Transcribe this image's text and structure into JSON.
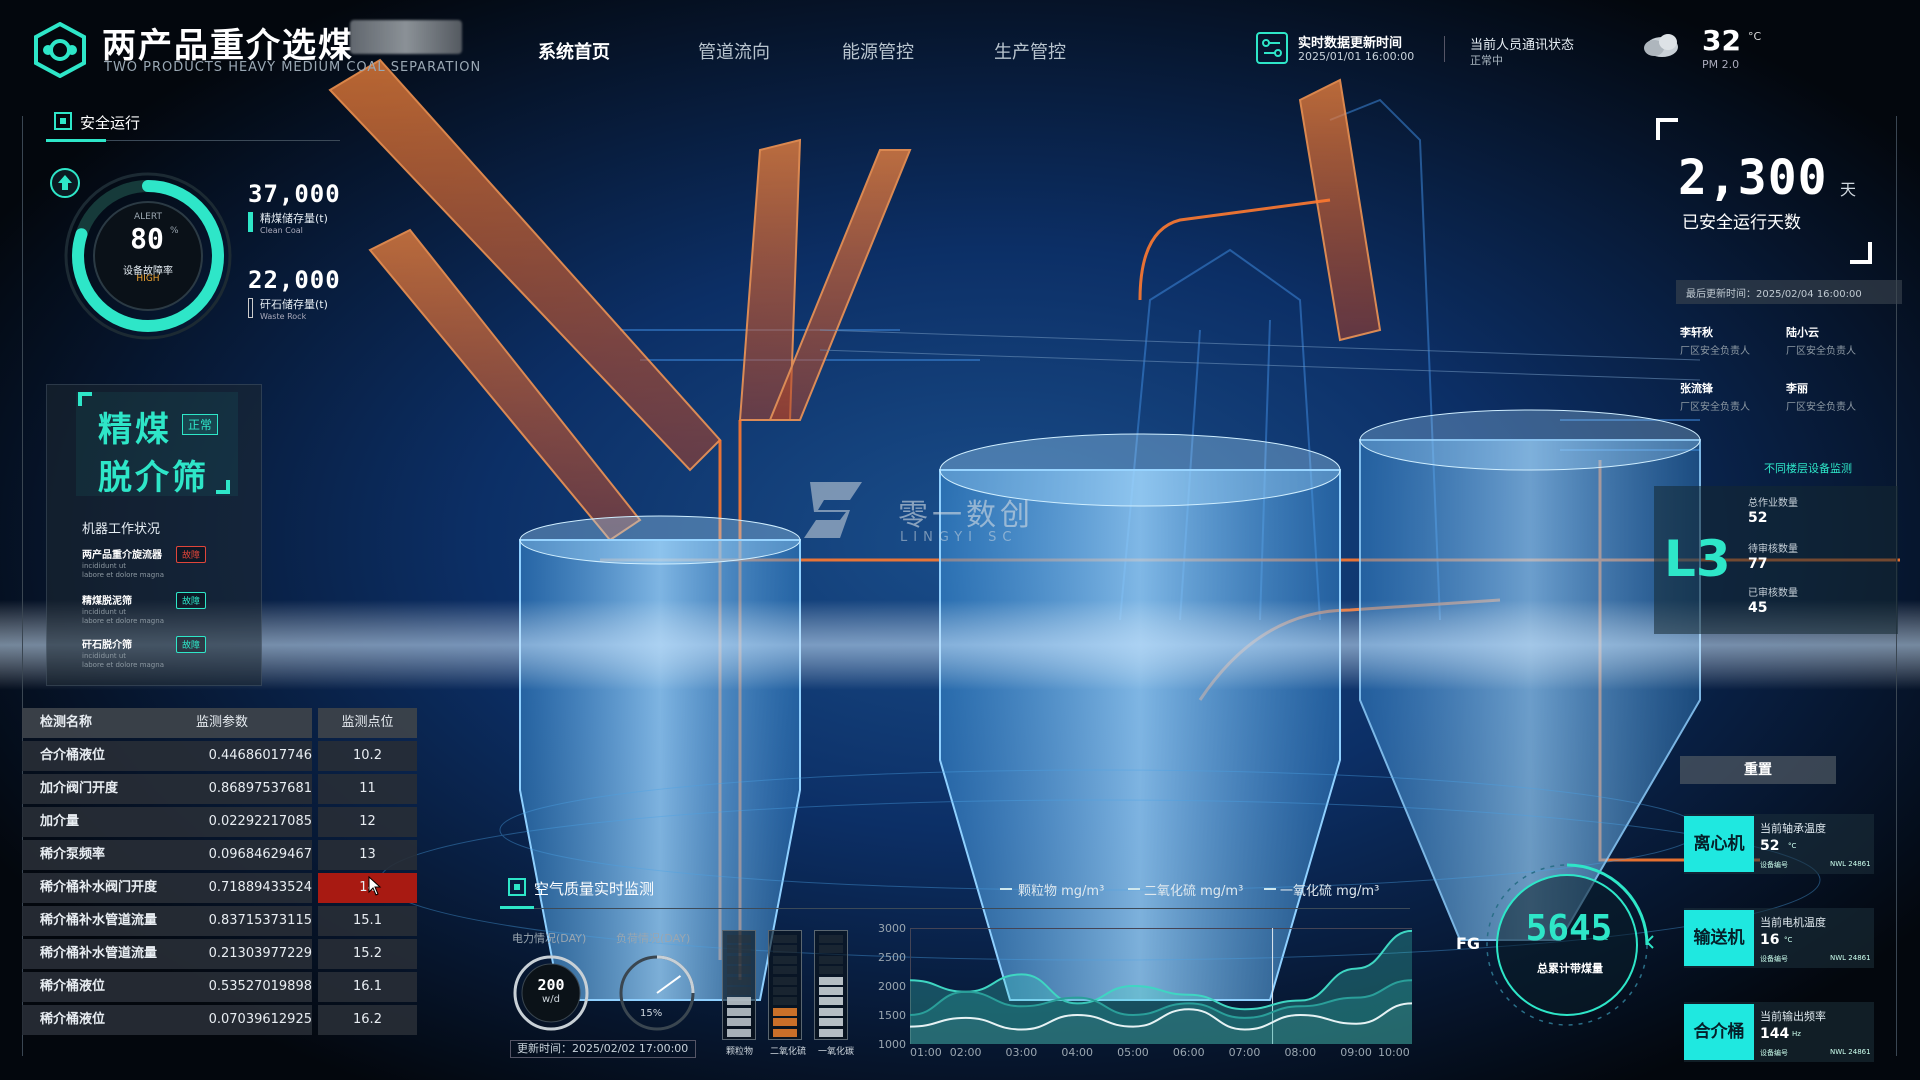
{
  "header": {
    "title": "两产品重介选煤",
    "subtitle": "TWO PRODUCTS HEAVY MEDIUM COAL SEPARATION",
    "nav": [
      "系统首页",
      "管道流向",
      "能源管控",
      "生产管控"
    ],
    "realtime_title": "实时数据更新时间",
    "realtime_time": "2025/01/01 16:00:00",
    "comm_title": "当前人员通讯状态",
    "comm_status": "正常中",
    "temperature": "32",
    "temp_unit": "°C",
    "pm": "PM 2.0"
  },
  "safety": {
    "title": "安全运行",
    "gauge_alert": "ALERT",
    "gauge_value": "80",
    "gauge_pct": "%",
    "gauge_label": "设备故障率",
    "gauge_level": "HIGH",
    "gauge_fraction": 0.8,
    "clean_value": "37,000",
    "clean_label": "精煤储存量(t)",
    "clean_en": "Clean Coal",
    "waste_value": "22,000",
    "waste_label": "矸石储存量(t)",
    "waste_en": "Waste Rock"
  },
  "equipment": {
    "line1": "精煤",
    "badge": "正常",
    "line2": "脱介筛",
    "work_title": "机器工作状况",
    "machines": [
      {
        "name": "两产品重介旋流器",
        "status": "故障",
        "color": "#e0453a",
        "sub1": "incididunt ut",
        "sub2": "labore et dolore magna"
      },
      {
        "name": "精煤脱泥筛",
        "status": "故障",
        "color": "#2ee6c8",
        "sub1": "incididunt ut",
        "sub2": "labore et dolore magna"
      },
      {
        "name": "矸石脱介筛",
        "status": "故障",
        "color": "#2ee6c8",
        "sub1": "incididunt ut",
        "sub2": "labore et dolore magna"
      }
    ]
  },
  "table": {
    "headers": [
      "检测名称",
      "监测参数",
      "监测点位"
    ],
    "rows": [
      {
        "name": "合介桶液位",
        "param": "0.44686017746",
        "point": "10.2"
      },
      {
        "name": "加介阀门开度",
        "param": "0.86897537681",
        "point": "11"
      },
      {
        "name": "加介量",
        "param": "0.02292217085",
        "point": "12"
      },
      {
        "name": "稀介泵频率",
        "param": "0.09684629467",
        "point": "13"
      },
      {
        "name": "稀介桶补水阀门开度",
        "param": "0.71889433524",
        "point": "14"
      },
      {
        "name": "稀介桶补水管道流量",
        "param": "0.83715373115",
        "point": "15.1"
      },
      {
        "name": "稀介桶补水管道流量",
        "param": "0.21303977229",
        "point": "15.2"
      },
      {
        "name": "稀介桶液位",
        "param": "0.53527019898",
        "point": "16.1"
      },
      {
        "name": "稀介桶液位",
        "param": "0.07039612925",
        "point": "16.2"
      }
    ]
  },
  "right": {
    "days": "2,300",
    "days_unit": "天",
    "days_label": "已安全运行天数",
    "last_update": "最后更新时间：2025/02/04 16:00:00",
    "people": [
      {
        "name": "李轩秋",
        "role": "厂区安全负责人"
      },
      {
        "name": "陆小云",
        "role": "厂区安全负责人"
      },
      {
        "name": "张流锋",
        "role": "厂区安全负责人"
      },
      {
        "name": "李丽",
        "role": "厂区安全负责人"
      }
    ],
    "floor_title": "不同楼层设备监测",
    "floor_name": "L3",
    "floor_stats": [
      {
        "label": "总作业数量",
        "value": "52"
      },
      {
        "label": "待审核数量",
        "value": "77"
      },
      {
        "label": "已审核数量",
        "value": "45"
      }
    ],
    "reset_label": "重置",
    "devices": [
      {
        "name": "离心机",
        "label": "当前轴承温度",
        "value": "52",
        "unit": "°C",
        "tag": "设备编号",
        "code": "NWL 24861"
      },
      {
        "name": "输送机",
        "label": "当前电机温度",
        "value": "16",
        "unit": "°C",
        "tag": "设备编号",
        "code": "NWL 24861"
      },
      {
        "name": "合介桶",
        "label": "当前输出频率",
        "value": "144",
        "unit": "Hz",
        "tag": "设备编号",
        "code": "NWL 24861"
      }
    ],
    "fg_label": "FG",
    "fg_value": "5645",
    "fg_unit": "t",
    "fg_caption": "总累计带煤量"
  },
  "air": {
    "title": "空气质量实时监测",
    "legend": [
      "颗粒物 mg/m³",
      "二氧化硫 mg/m³",
      "一氧化硫 mg/m³"
    ],
    "power_label": "电力情况(DAY)",
    "power_value": "200",
    "power_unit": "w/d",
    "load_label": "负荷情况(DAY)",
    "load_value": "15%",
    "load_fraction": 0.15,
    "update": "更新时间：2025/02/02 17:00:00",
    "bar_labels": [
      "颗粒物",
      "二氧化硫",
      "一氧化碳"
    ],
    "bar_levels": [
      0.4,
      0.3,
      0.55
    ],
    "bar_colors": [
      "#b9c2c8",
      "#e07a2a",
      "#c9d0d6"
    ]
  },
  "watermark": {
    "brand": "零一数创",
    "en": "LINGYI SC"
  },
  "chart_data": {
    "type": "area",
    "x": [
      "01:00",
      "02:00",
      "03:00",
      "04:00",
      "05:00",
      "06:00",
      "07:00",
      "08:00",
      "09:00",
      "10:00"
    ],
    "ylim": [
      1000,
      3000
    ],
    "yticks": [
      "3000",
      "2500",
      "2000",
      "1500",
      "1000"
    ],
    "series": [
      {
        "name": "颗粒物 mg/m³",
        "color": "#3fd6c2",
        "values": [
          2100,
          1900,
          2200,
          1700,
          2000,
          1850,
          1600,
          1750,
          2300,
          2950
        ]
      },
      {
        "name": "二氧化硫 mg/m³",
        "color": "#2a9f9a",
        "values": [
          1500,
          1900,
          1650,
          1800,
          1500,
          1700,
          1450,
          1650,
          1800,
          2100
        ]
      },
      {
        "name": "一氧化硫 mg/m³",
        "color": "#e6f2f4",
        "values": [
          1300,
          1450,
          1250,
          1500,
          1300,
          1600,
          1250,
          1500,
          1350,
          1700
        ]
      }
    ]
  }
}
